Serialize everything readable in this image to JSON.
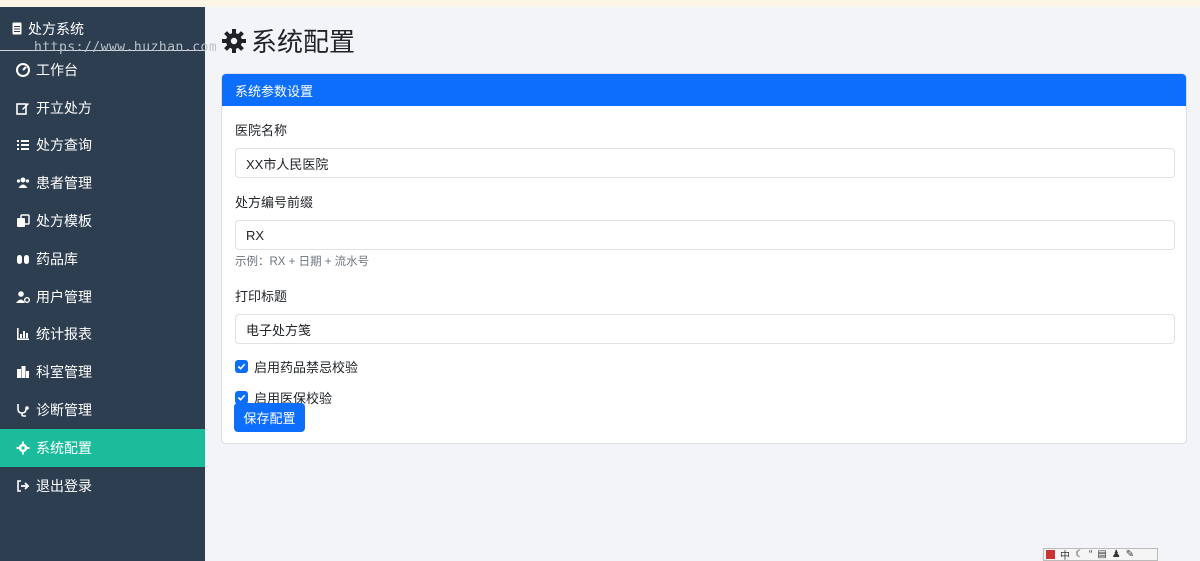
{
  "sidebar": {
    "brand": "处方系统",
    "watermark": "https://www.huzhan.com",
    "items": [
      {
        "label": "工作台",
        "icon": "gauge-icon",
        "active": false
      },
      {
        "label": "开立处方",
        "icon": "edit-icon",
        "active": false
      },
      {
        "label": "处方查询",
        "icon": "list-icon",
        "active": false
      },
      {
        "label": "患者管理",
        "icon": "users-icon",
        "active": false
      },
      {
        "label": "处方模板",
        "icon": "clone-icon",
        "active": false
      },
      {
        "label": "药品库",
        "icon": "pills-icon",
        "active": false
      },
      {
        "label": "用户管理",
        "icon": "user-cog-icon",
        "active": false
      },
      {
        "label": "统计报表",
        "icon": "chart-icon",
        "active": false
      },
      {
        "label": "科室管理",
        "icon": "building-icon",
        "active": false
      },
      {
        "label": "诊断管理",
        "icon": "stethoscope-icon",
        "active": false
      },
      {
        "label": "系统配置",
        "icon": "gear-icon",
        "active": true
      },
      {
        "label": "退出登录",
        "icon": "logout-icon",
        "active": false
      }
    ]
  },
  "page": {
    "title": "系统配置"
  },
  "card": {
    "header": "系统参数设置",
    "hospital_label": "医院名称",
    "hospital_value": "XX市人民医院",
    "prefix_label": "处方编号前缀",
    "prefix_value": "RX",
    "prefix_hint": "示例：RX + 日期 + 流水号",
    "print_label": "打印标题",
    "print_value": "电子处方笺",
    "check1_label": "启用药品禁忌校验",
    "check1_checked": true,
    "check2_label": "启用医保校验",
    "check2_checked": true,
    "save_label": "保存配置"
  },
  "ime": {
    "text": "中"
  },
  "colors": {
    "sidebar_bg": "#2c3e50",
    "active_bg": "#1abc9c",
    "primary": "#0d6efd"
  }
}
